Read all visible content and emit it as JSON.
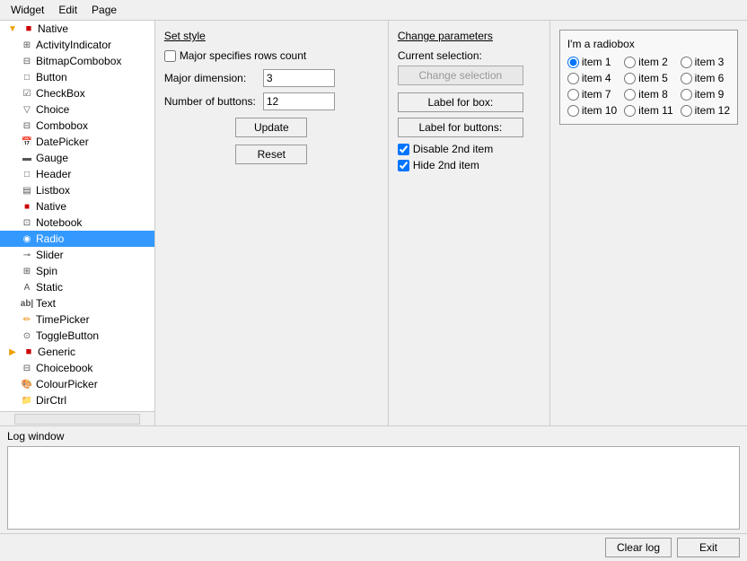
{
  "menubar": {
    "items": [
      "Widget",
      "Edit",
      "Page"
    ]
  },
  "tree": {
    "native_label": "Native",
    "generic_label": "Generic",
    "native_items": [
      "ActivityIndicator",
      "BitmapCombobox",
      "Button",
      "CheckBox",
      "Choice",
      "Combobox",
      "DatePicker",
      "Gauge",
      "Header",
      "Listbox",
      "Native",
      "Notebook",
      "Radio",
      "Slider",
      "Spin",
      "Static",
      "Text",
      "TimePicker",
      "ToggleButton"
    ],
    "generic_items": [
      "Choicebook",
      "ColourPicker",
      "DirCtrl"
    ],
    "selected": "Radio"
  },
  "style_panel": {
    "title": "Set style",
    "checkbox_label": "Major specifies rows count",
    "major_label": "Major dimension:",
    "major_value": "3",
    "num_buttons_label": "Number of buttons:",
    "num_buttons_value": "12",
    "update_label": "Update",
    "reset_label": "Reset"
  },
  "change_panel": {
    "title": "Change parameters",
    "current_selection_label": "Current selection:",
    "change_selection_label": "Change selection",
    "label_for_box_label": "Label for box:",
    "label_for_buttons_label": "Label for buttons:",
    "disable_label": "Disable 2nd item",
    "hide_label": "Hide 2nd item",
    "disable_checked": true,
    "hide_checked": true
  },
  "radio_panel": {
    "title": "I'm a radiobox",
    "items": [
      "item 1",
      "item 2",
      "item 3",
      "item 4",
      "item 5",
      "item 6",
      "item 7",
      "item 8",
      "item 9",
      "item 10",
      "item 11",
      "item 12"
    ],
    "selected_index": 0
  },
  "log": {
    "title": "Log window"
  },
  "bottom": {
    "clear_log_label": "Clear log",
    "exit_label": "Exit"
  }
}
